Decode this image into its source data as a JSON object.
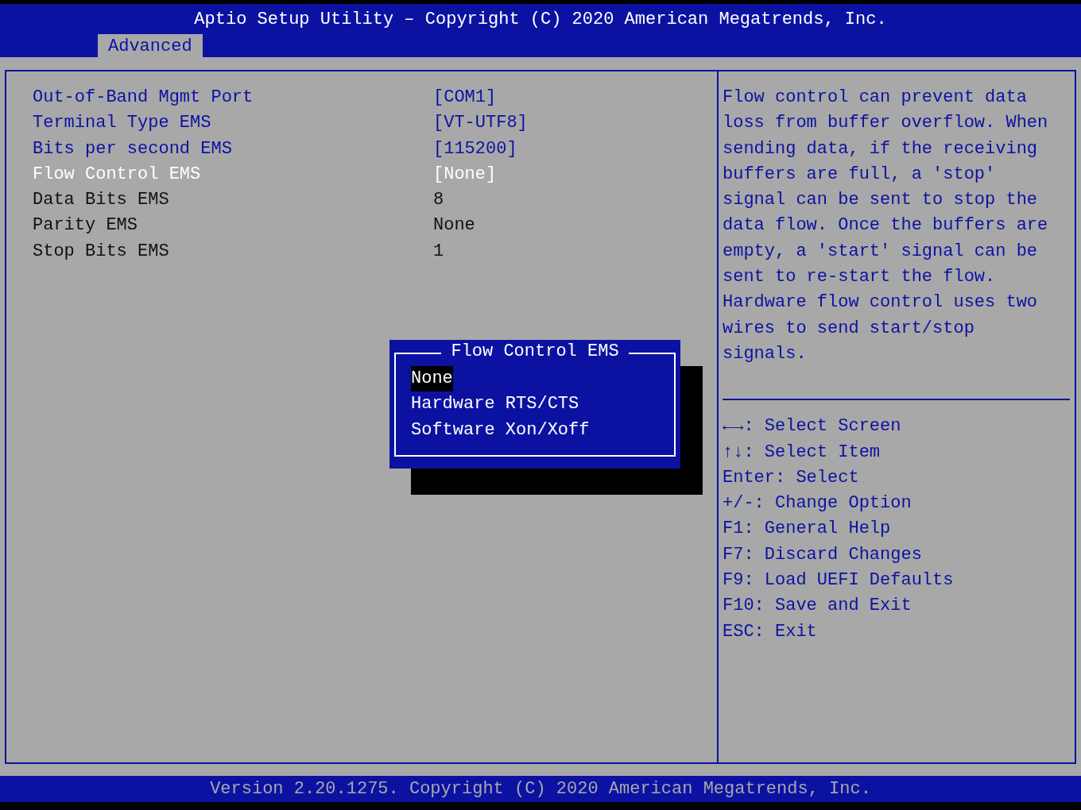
{
  "header": {
    "title": "Aptio Setup Utility – Copyright (C) 2020 American Megatrends, Inc.",
    "tabs": [
      {
        "label": "Advanced",
        "selected": true
      }
    ]
  },
  "settings": [
    {
      "label": "Out-of-Band Mgmt Port",
      "value": "[COM1]",
      "kind": "option",
      "selected": false
    },
    {
      "label": "Terminal Type EMS",
      "value": "[VT-UTF8]",
      "kind": "option",
      "selected": false
    },
    {
      "label": "Bits per second EMS",
      "value": "[115200]",
      "kind": "option",
      "selected": false
    },
    {
      "label": "Flow Control EMS",
      "value": "[None]",
      "kind": "option",
      "selected": true
    },
    {
      "label": "Data Bits EMS",
      "value": "8",
      "kind": "info",
      "selected": false
    },
    {
      "label": "Parity EMS",
      "value": "None",
      "kind": "info",
      "selected": false
    },
    {
      "label": "Stop Bits EMS",
      "value": "1",
      "kind": "info",
      "selected": false
    }
  ],
  "help_text": "Flow control can prevent data loss from buffer overflow. When sending data, if the receiving buffers are full, a 'stop' signal can be sent to stop the data flow. Once the buffers are empty, a 'start' signal can be sent to re-start the flow. Hardware flow control uses two wires to send start/stop signals.",
  "key_help": [
    "←→: Select Screen",
    "↑↓: Select Item",
    "Enter: Select",
    "+/-: Change Option",
    "F1: General Help",
    "F7: Discard Changes",
    "F9: Load UEFI Defaults",
    "F10: Save and Exit",
    "ESC: Exit"
  ],
  "popup": {
    "title": "Flow Control EMS",
    "options": [
      {
        "label": "None",
        "selected": true
      },
      {
        "label": "Hardware RTS/CTS",
        "selected": false
      },
      {
        "label": "Software Xon/Xoff",
        "selected": false
      }
    ]
  },
  "footer": "Version 2.20.1275. Copyright (C) 2020 American Megatrends, Inc."
}
